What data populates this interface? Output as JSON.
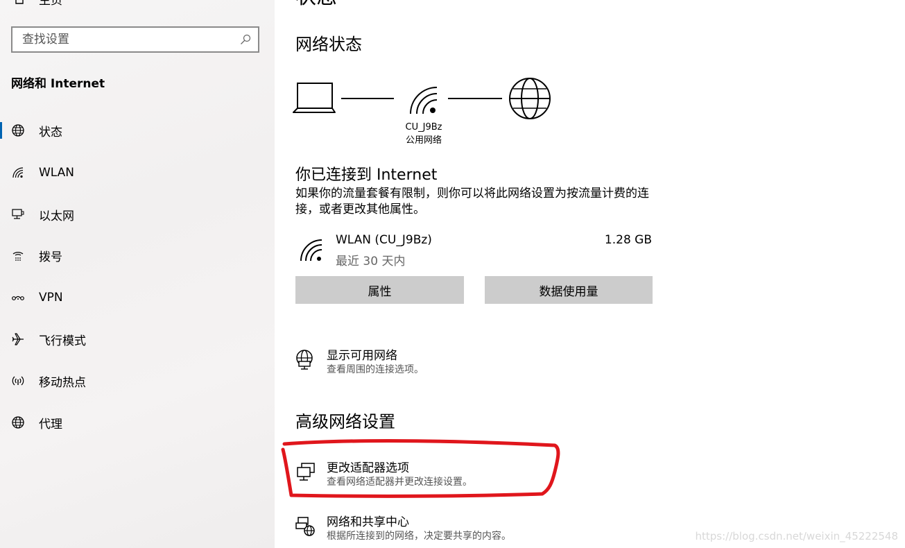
{
  "sidebar": {
    "home_label": "主页",
    "search": {
      "placeholder": "查找设置",
      "value": ""
    },
    "section_title": "网络和 Internet",
    "items": [
      {
        "label": "状态",
        "icon": "globe-icon",
        "active": true
      },
      {
        "label": "WLAN",
        "icon": "wifi-icon",
        "active": false
      },
      {
        "label": "以太网",
        "icon": "ethernet-icon",
        "active": false
      },
      {
        "label": "拨号",
        "icon": "dialup-icon",
        "active": false
      },
      {
        "label": "VPN",
        "icon": "vpn-icon",
        "active": false
      },
      {
        "label": "飞行模式",
        "icon": "airplane-icon",
        "active": false
      },
      {
        "label": "移动热点",
        "icon": "hotspot-icon",
        "active": false
      },
      {
        "label": "代理",
        "icon": "globe-icon",
        "active": false
      }
    ]
  },
  "main": {
    "page_title": "状态",
    "network_status_title": "网络状态",
    "diagram": {
      "network_name": "CU_J9Bz",
      "network_type": "公用网络"
    },
    "connected_title": "你已连接到 Internet",
    "connected_desc": "如果你的流量套餐有限制，则你可以将此网络设置为按流量计费的连接，或者更改其他属性。",
    "connection": {
      "name": "WLAN (CU_J9Bz)",
      "period": "最近 30 天内",
      "usage": "1.28 GB"
    },
    "buttons": {
      "properties": "属性",
      "data_usage": "数据使用量"
    },
    "show_networks": {
      "title": "显示可用网络",
      "subtitle": "查看周围的连接选项。"
    },
    "advanced_title": "高级网络设置",
    "change_adapter": {
      "title": "更改适配器选项",
      "subtitle": "查看网络适配器并更改连接设置。"
    },
    "sharing_center": {
      "title": "网络和共享中心",
      "subtitle": "根据所连接到的网络，决定要共享的内容。"
    }
  },
  "watermark": "https://blog.csdn.net/weixin_45222548",
  "colors": {
    "accent": "#0063b1",
    "button_bg": "#cccccc",
    "annotation": "#e0161c"
  }
}
